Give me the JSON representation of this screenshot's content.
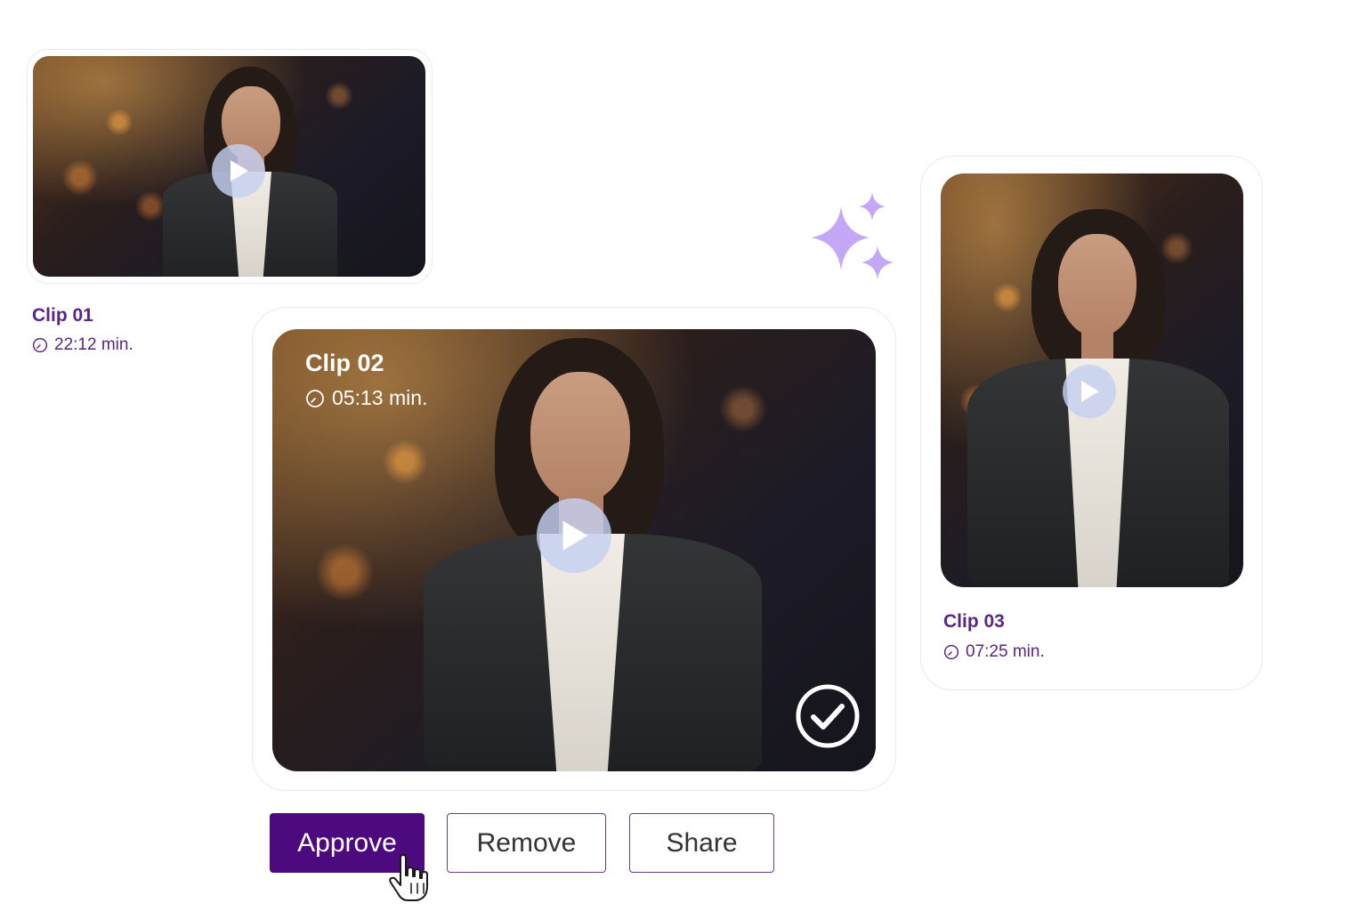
{
  "clips": [
    {
      "title": "Clip 01",
      "duration": "22:12 min."
    },
    {
      "title": "Clip 02",
      "duration": "05:13 min."
    },
    {
      "title": "Clip 03",
      "duration": "07:25 min."
    }
  ],
  "actions": {
    "approve_label": "Approve",
    "remove_label": "Remove",
    "share_label": "Share"
  },
  "colors": {
    "brand_purple": "#4d0a7e",
    "label_purple": "#5b2582",
    "sparkle_lavender": "#c4a8f5",
    "play_button": "#c4d0f0"
  },
  "icons": {
    "play": "play-icon",
    "clock": "clock-icon",
    "approved": "check-circle-icon",
    "sparkle": "sparkle-icon",
    "cursor": "hand-pointer-icon"
  },
  "state": {
    "selected_clip": "Clip 02"
  }
}
